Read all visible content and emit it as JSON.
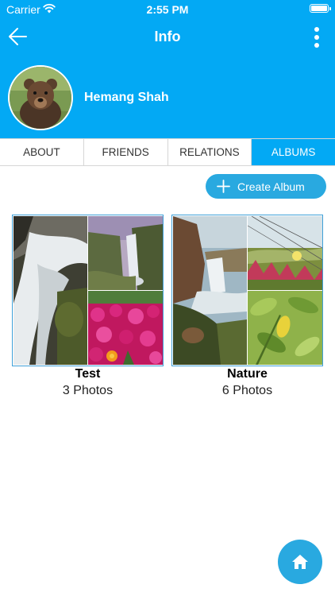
{
  "status_bar": {
    "carrier": "Carrier",
    "time": "2:55 PM"
  },
  "nav": {
    "title": "Info",
    "back_icon": "arrow-left-icon",
    "more_icon": "more-vertical-icon"
  },
  "profile": {
    "name": "Hemang Shah",
    "avatar": "bear-avatar"
  },
  "tabs": [
    {
      "label": "ABOUT",
      "active": false
    },
    {
      "label": "FRIENDS",
      "active": false
    },
    {
      "label": "RELATIONS",
      "active": false
    },
    {
      "label": "ALBUMS",
      "active": true
    }
  ],
  "create_album": {
    "label": "Create Album",
    "icon": "plus-icon"
  },
  "albums": [
    {
      "title": "Test",
      "count": "3 Photos"
    },
    {
      "title": "Nature",
      "count": "6 Photos"
    }
  ],
  "home_button": {
    "icon": "home-icon"
  },
  "colors": {
    "primary": "#03A9F4",
    "button": "#29A9E0",
    "tab_border": "#d6d6d6"
  }
}
